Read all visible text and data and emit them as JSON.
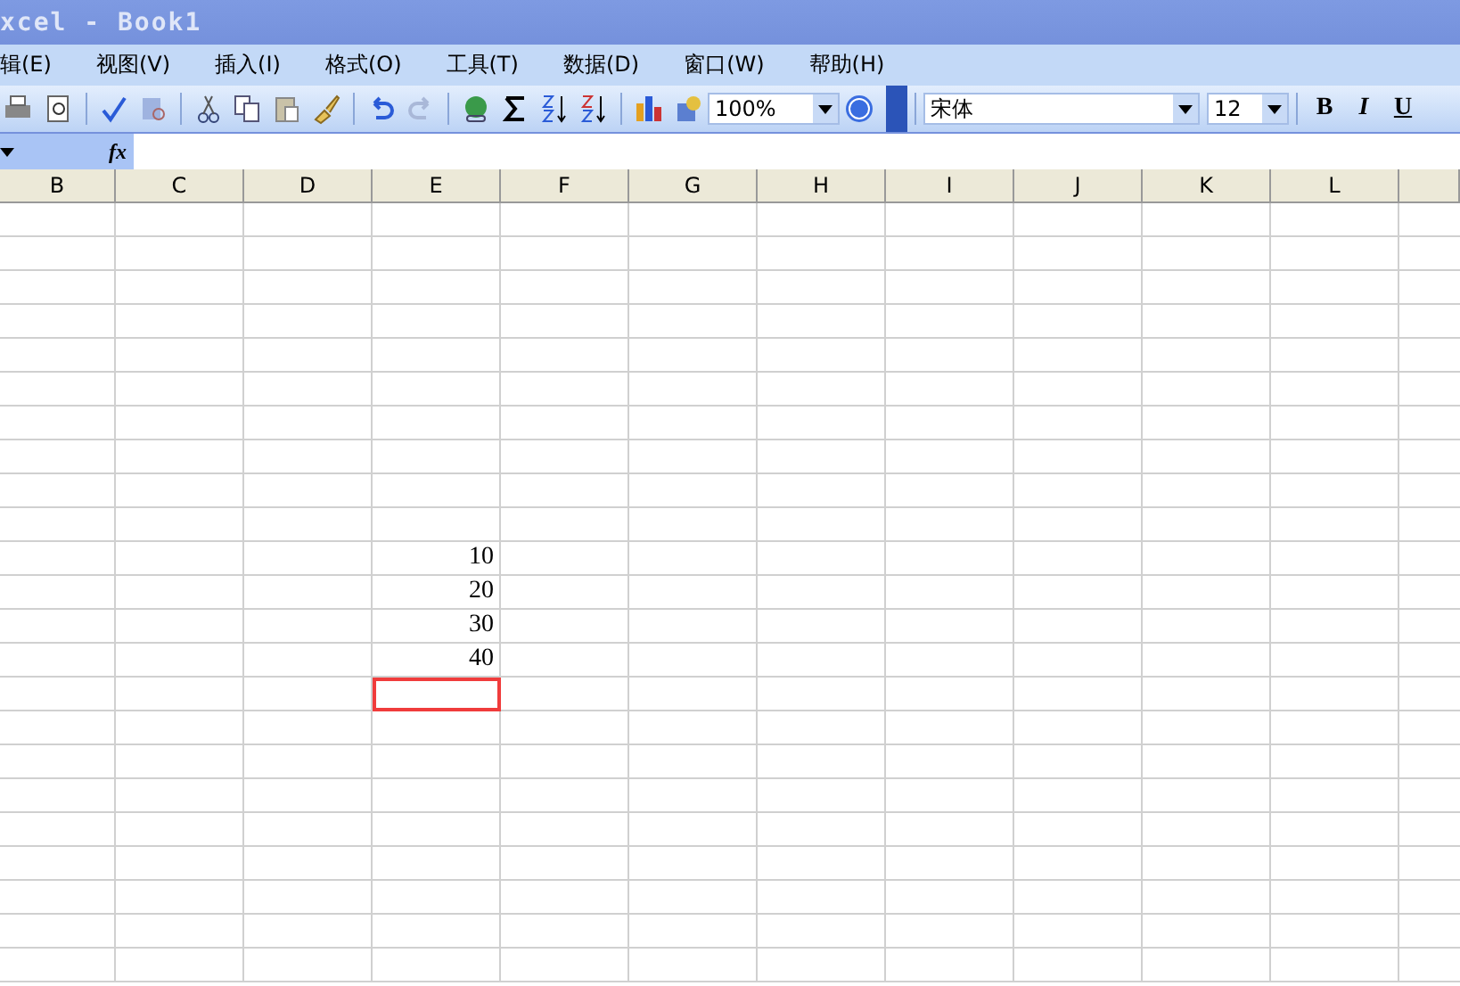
{
  "window": {
    "title": "xcel - Book1"
  },
  "menu": [
    {
      "label": "辑(E)"
    },
    {
      "label": "视图(V)"
    },
    {
      "label": "插入(I)"
    },
    {
      "label": "格式(O)"
    },
    {
      "label": "工具(T)"
    },
    {
      "label": "数据(D)"
    },
    {
      "label": "窗口(W)"
    },
    {
      "label": "帮助(H)"
    }
  ],
  "toolbar": {
    "zoom": "100%",
    "font": "宋体",
    "font_size": "12",
    "format_buttons": [
      "B",
      "I",
      "U"
    ]
  },
  "formula_bar": {
    "fx": "fx"
  },
  "sheet": {
    "columns": [
      "B",
      "C",
      "D",
      "E",
      "F",
      "G",
      "H",
      "I",
      "J",
      "K",
      "L"
    ],
    "rows": [
      {},
      {},
      {},
      {},
      {},
      {},
      {},
      {},
      {},
      {},
      {
        "E": {
          "text": "10",
          "selected": false
        }
      },
      {
        "E": {
          "text": "20",
          "selected": false
        }
      },
      {
        "E": {
          "text": "30",
          "selected": false
        }
      },
      {
        "E": {
          "text": "40",
          "selected": false
        }
      },
      {
        "E": {
          "selected": true
        }
      },
      {},
      {},
      {},
      {},
      {},
      {},
      {},
      {}
    ]
  }
}
